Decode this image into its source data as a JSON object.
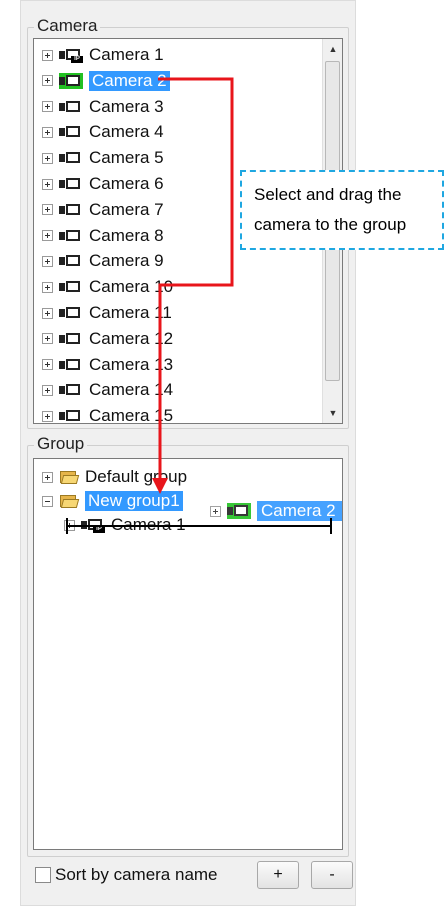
{
  "camera_section": {
    "title": "Camera",
    "cameras": [
      {
        "label": "Camera 1"
      },
      {
        "label": "Camera 2"
      },
      {
        "label": "Camera 3"
      },
      {
        "label": "Camera 4"
      },
      {
        "label": "Camera 5"
      },
      {
        "label": "Camera 6"
      },
      {
        "label": "Camera 7"
      },
      {
        "label": "Camera 8"
      },
      {
        "label": "Camera 9"
      },
      {
        "label": "Camera 10"
      },
      {
        "label": "Camera 11"
      },
      {
        "label": "Camera 12"
      },
      {
        "label": "Camera 13"
      },
      {
        "label": "Camera 14"
      },
      {
        "label": "Camera 15"
      }
    ],
    "selected": "Camera 2"
  },
  "group_section": {
    "title": "Group",
    "groups": [
      {
        "label": "Default group"
      },
      {
        "label": "New group1",
        "children": [
          {
            "label": "Camera 1"
          }
        ]
      }
    ],
    "drag_item": {
      "label": "Camera 2"
    }
  },
  "footer": {
    "sort_label": "Sort by camera name",
    "add_label": "+",
    "remove_label": "-"
  },
  "callout": {
    "line1": "Select and drag the",
    "line2": "camera to the group"
  },
  "colors": {
    "selection": "#3399ff",
    "arrow": "#e8151b",
    "callout_border": "#1fa7e1",
    "online_icon": "#22c022"
  }
}
